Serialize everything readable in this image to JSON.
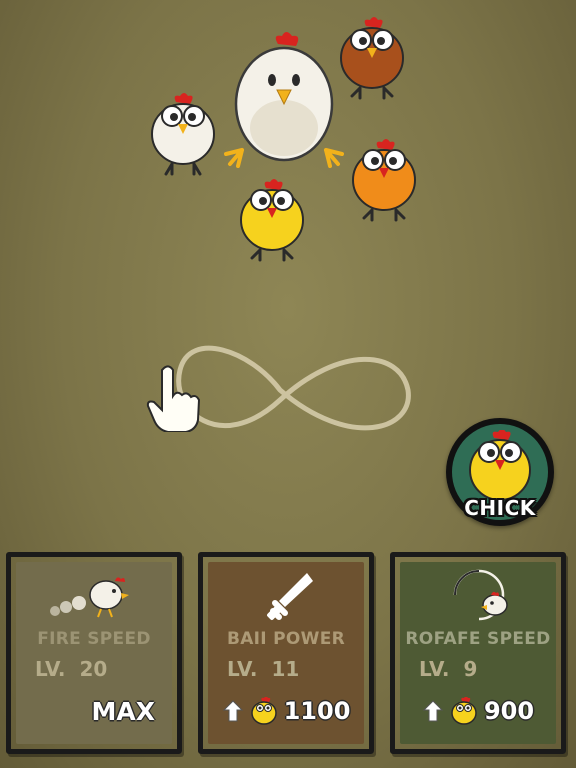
{
  "colors": {
    "background": "#8a8252",
    "chick_yellow": "#f6d21e",
    "chick_white": "#f4f1e8",
    "chick_brown": "#a8501c",
    "chick_orange": "#f08c1a",
    "chick_button_ring": "#2f6d55"
  },
  "chick_button": {
    "label": "CHICK",
    "icon": "chick-icon"
  },
  "gesture": {
    "icon": "pointing-hand-icon",
    "path": "infinity-gesture"
  },
  "upgrades": [
    {
      "title": "FIRE SPEED",
      "level_prefix": "LV.",
      "level": "20",
      "status": "MAX",
      "icon": "chicken-fire-icon"
    },
    {
      "title": "BAII POWER",
      "level_prefix": "LV.",
      "level": "11",
      "cost": "1100",
      "icon": "knife-icon",
      "cost_icon": "upgrade-arrow-chick-icon"
    },
    {
      "title": "ROFAFE SPEED",
      "level_prefix": "LV.",
      "level": "9",
      "cost": "900",
      "icon": "rotate-chicken-icon",
      "cost_icon": "upgrade-arrow-chick-icon"
    }
  ]
}
